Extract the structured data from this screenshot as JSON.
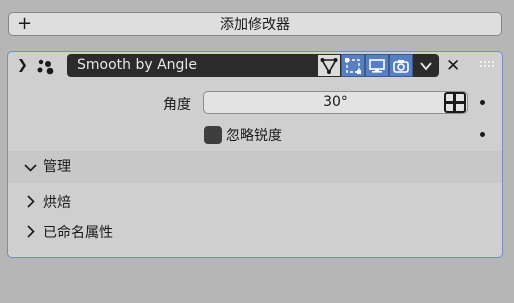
{
  "add_modifier": {
    "label": "添加修改器",
    "icon": "plus-icon"
  },
  "modifier": {
    "name": "Smooth by Angle",
    "icons": [
      "chevron-down-icon",
      "modifier-dots-icon",
      "node-tree-icon",
      "edit-mode-icon",
      "monitor-icon",
      "camera-icon",
      "chevron-down-icon",
      "close-icon",
      "drag-handle-icon"
    ]
  },
  "angle": {
    "label": "角度",
    "value": "30°"
  },
  "ignore_sharp": {
    "label": "忽略锐度",
    "checked": false
  },
  "subpanels": {
    "manage": {
      "label": "管理",
      "expanded": true
    },
    "bake": {
      "label": "烘焙",
      "expanded": false
    },
    "named_attributes": {
      "label": "已命名属性",
      "expanded": false
    }
  },
  "colors": {
    "accent": "#5680c2",
    "panel": "#cfcfcf",
    "background": "#b6b6b6",
    "field_dark": "#2b2b2b"
  }
}
